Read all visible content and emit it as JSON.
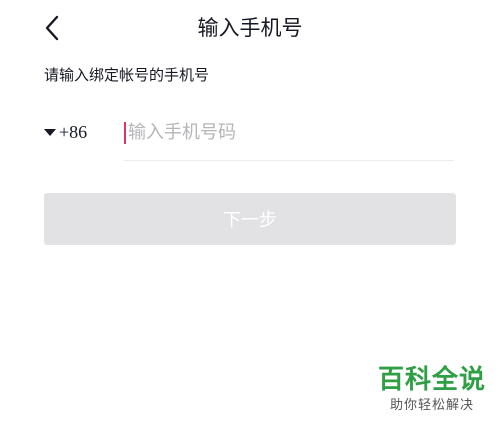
{
  "header": {
    "back_icon": "chevron-left-icon",
    "title": "输入手机号"
  },
  "form": {
    "subtitle": "请输入绑定帐号的手机号",
    "country_code": "+86",
    "country_caret_icon": "caret-down-icon",
    "phone_value": "",
    "phone_placeholder": "输入手机号码",
    "next_label": "下一步"
  },
  "watermark": {
    "logo": "百科全说",
    "slogan": "助你轻松解决"
  },
  "colors": {
    "text": "#161823",
    "placeholder": "#b4b5b8",
    "cursor": "#e1355b",
    "button_disabled_bg": "#e2e2e4",
    "watermark_green": "#2f9e44"
  }
}
